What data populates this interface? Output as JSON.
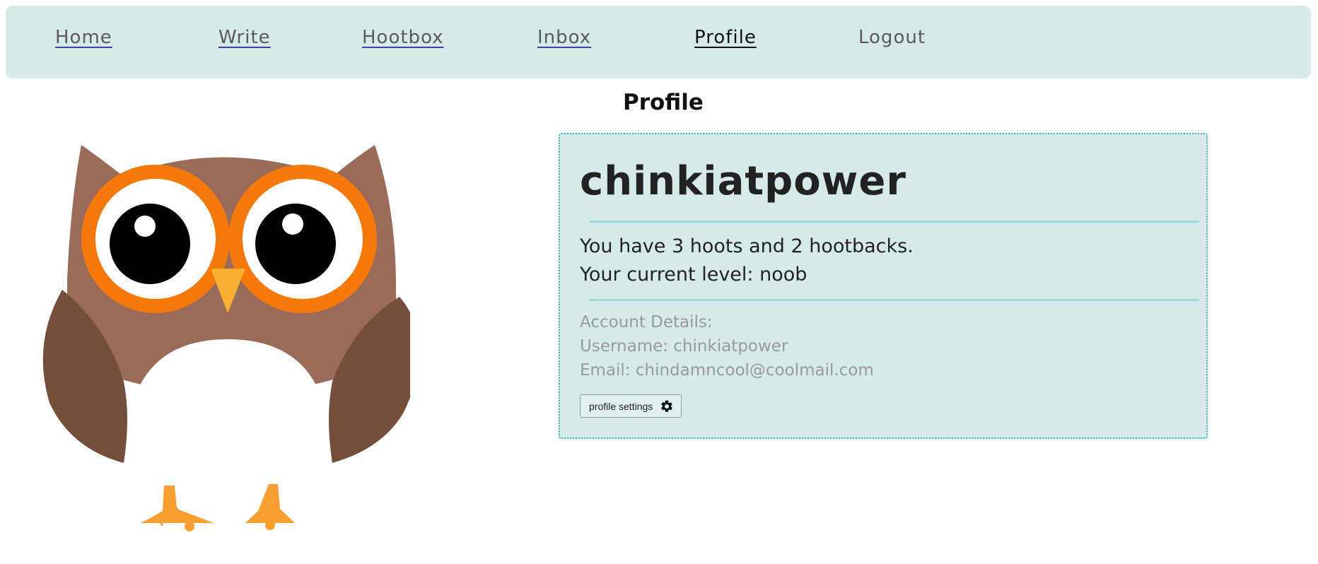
{
  "nav": {
    "items": [
      {
        "label": "Home"
      },
      {
        "label": "Write"
      },
      {
        "label": "Hootbox"
      },
      {
        "label": "Inbox"
      },
      {
        "label": "Profile"
      },
      {
        "label": "Logout"
      }
    ]
  },
  "page": {
    "title": "Profile"
  },
  "profile": {
    "username": "chinkiatpower",
    "stats_line": "You have 3 hoots and 2 hootbacks.",
    "level_line": "Your current level: noob",
    "details_heading": "Account Details:",
    "username_line": "Username: chinkiatpower",
    "email_line": "Email: chindamncool@coolmail.com",
    "settings_label": "profile settings"
  },
  "icons": {
    "settings": "gear-icon",
    "avatar": "owl-illustration"
  },
  "colors": {
    "panel_bg": "#d6eae9",
    "card_border": "#2fb5b0",
    "divider": "#9fd9cf",
    "muted_text": "#9a9a9a"
  }
}
